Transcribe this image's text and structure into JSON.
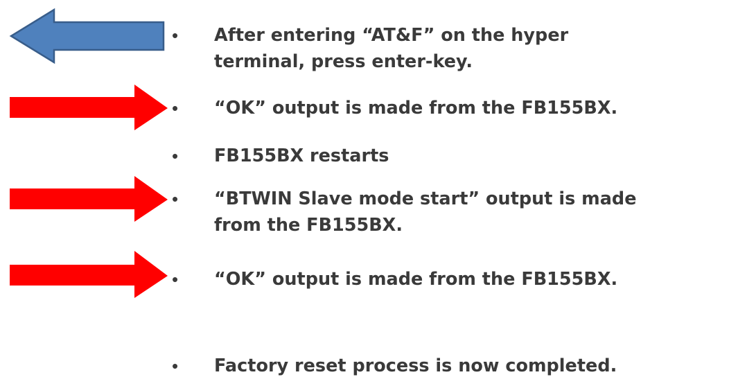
{
  "bullets": [
    {
      "text": "After entering “AT&F” on the hyper\nterminal, press enter-key."
    },
    {
      "text": "“OK” output is made from the FB155BX."
    },
    {
      "text": "FB155BX restarts"
    },
    {
      "text": "“BTWIN Slave mode start” output is made\nfrom the FB155BX."
    },
    {
      "text": "“OK” output is made from the FB155BX."
    },
    {
      "text": "Factory reset process is now completed."
    }
  ],
  "bullet_char": "•",
  "arrows": [
    {
      "direction": "left",
      "color": "#4f81bd",
      "outline": "#385d8a"
    },
    {
      "direction": "right",
      "color": "#ff0000"
    },
    {
      "direction": "right",
      "color": "#ff0000"
    },
    {
      "direction": "right",
      "color": "#ff0000"
    }
  ]
}
